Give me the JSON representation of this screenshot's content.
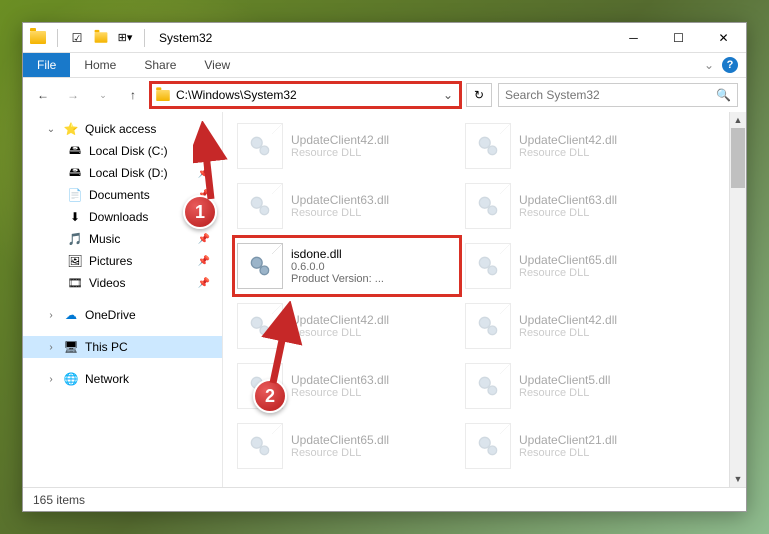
{
  "window": {
    "title": "System32"
  },
  "tabs": {
    "file": "File",
    "home": "Home",
    "share": "Share",
    "view": "View"
  },
  "address": {
    "path": "C:\\Windows\\System32"
  },
  "search": {
    "placeholder": "Search System32"
  },
  "sidebar": {
    "quick_access": "Quick access",
    "local_c": "Local Disk (C:)",
    "local_d": "Local Disk (D:)",
    "documents": "Documents",
    "downloads": "Downloads",
    "music": "Music",
    "pictures": "Pictures",
    "videos": "Videos",
    "onedrive": "OneDrive",
    "this_pc": "This PC",
    "network": "Network"
  },
  "files": [
    {
      "name": "UpdateClient42.dll",
      "sub": "Resource DLL"
    },
    {
      "name": "UpdateClient42.dll",
      "sub": "Resource DLL"
    },
    {
      "name": "UpdateClient63.dll",
      "sub": "Resource DLL"
    },
    {
      "name": "UpdateClient63.dll",
      "sub": "Resource DLL"
    },
    {
      "name": "isdone.dll",
      "sub1": "0.6.0.0",
      "sub2": "Product Version:   ...",
      "highlight": true
    },
    {
      "name": "UpdateClient65.dll",
      "sub": "Resource DLL"
    },
    {
      "name": "UpdateClient42.dll",
      "sub": "Resource DLL"
    },
    {
      "name": "UpdateClient42.dll",
      "sub": "Resource DLL"
    },
    {
      "name": "UpdateClient63.dll",
      "sub": "Resource DLL"
    },
    {
      "name": "UpdateClient5.dll",
      "sub": "Resource DLL"
    },
    {
      "name": "UpdateClient65.dll",
      "sub": "Resource DLL"
    },
    {
      "name": "UpdateClient21.dll",
      "sub": "Resource DLL"
    }
  ],
  "status": {
    "count": "165 items"
  },
  "annotations": {
    "badge1": "1",
    "badge2": "2"
  }
}
